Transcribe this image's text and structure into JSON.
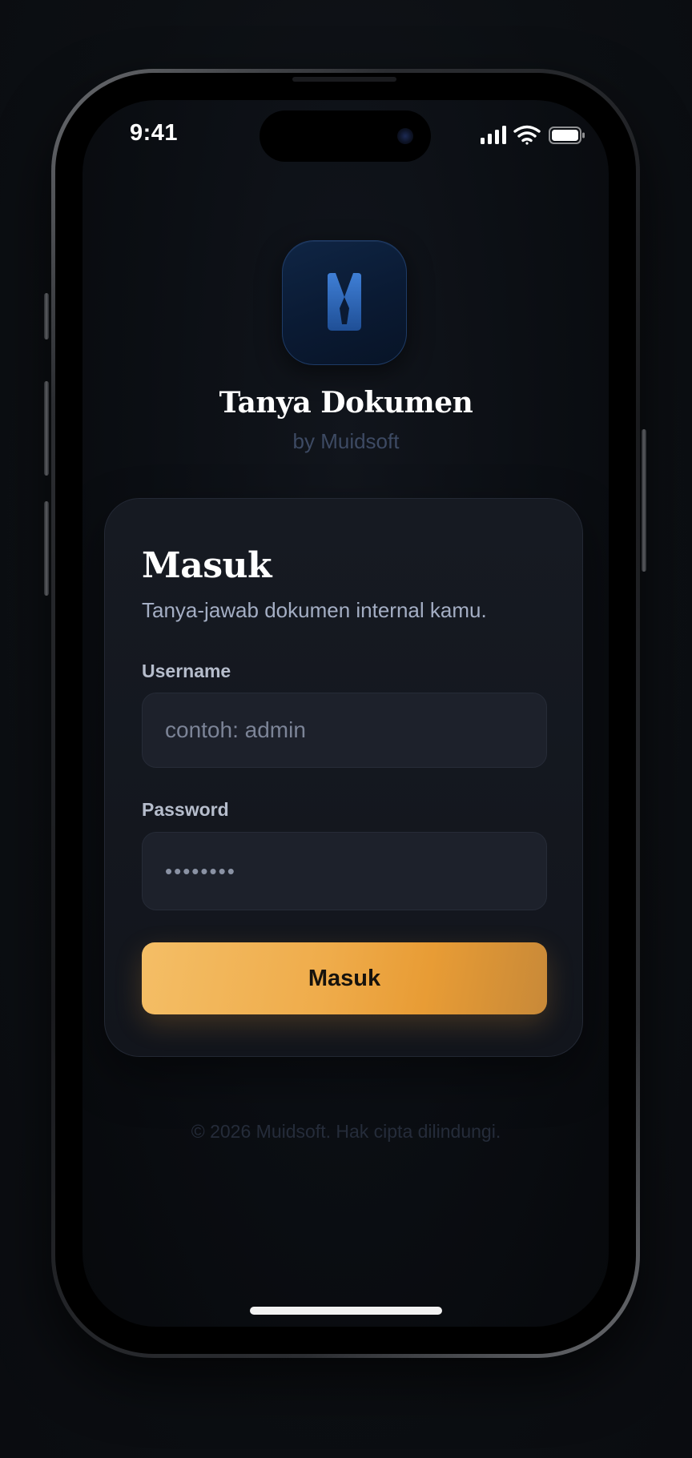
{
  "status_bar": {
    "time": "9:41",
    "icons": [
      "cellular-signal-icon",
      "wifi-icon",
      "battery-icon"
    ]
  },
  "app": {
    "icon": "bookmark-tie-logo-icon",
    "title": "Tanya Dokumen",
    "subtitle": "by Muidsoft"
  },
  "login": {
    "title": "Masuk",
    "description": "Tanya-jawab dokumen internal kamu.",
    "username": {
      "label": "Username",
      "value": "",
      "placeholder": "contoh: admin"
    },
    "password": {
      "label": "Password",
      "value": "",
      "placeholder": "••••••••"
    },
    "submit_label": "Masuk"
  },
  "footer": {
    "text": "© 2026 Muidsoft. Hak cipta dilindungi."
  },
  "colors": {
    "accent": "#efac4b",
    "background": "#0c0f13",
    "card": "#161a22",
    "input": "#1d212b"
  }
}
